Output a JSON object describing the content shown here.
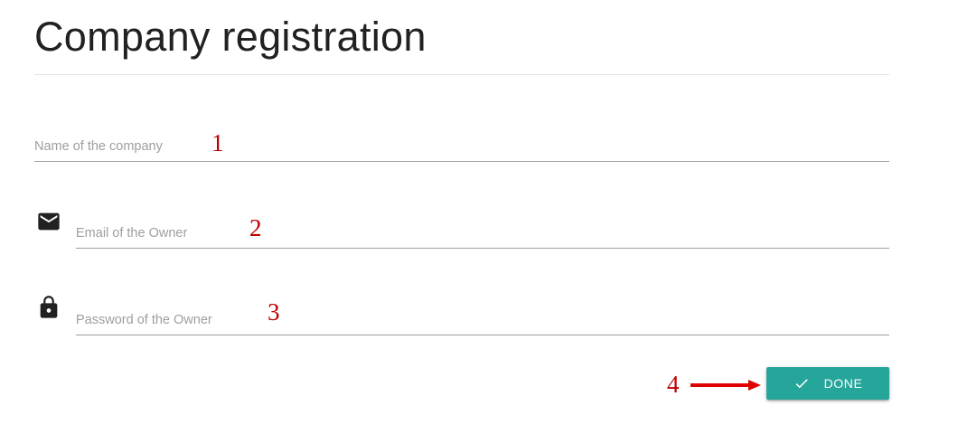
{
  "page": {
    "title": "Company registration"
  },
  "form": {
    "company": {
      "placeholder": "Name of the company",
      "value": ""
    },
    "email": {
      "placeholder": "Email of the Owner",
      "value": "",
      "icon": "email-icon"
    },
    "password": {
      "placeholder": "Password of the Owner",
      "value": "",
      "icon": "lock-icon"
    },
    "submit": {
      "label": "DONE",
      "icon": "check-icon",
      "color": "#26a69a"
    }
  },
  "annotations": {
    "markers": [
      "1",
      "2",
      "3",
      "4"
    ],
    "color": "#c00000",
    "arrow_target": "done-button"
  }
}
